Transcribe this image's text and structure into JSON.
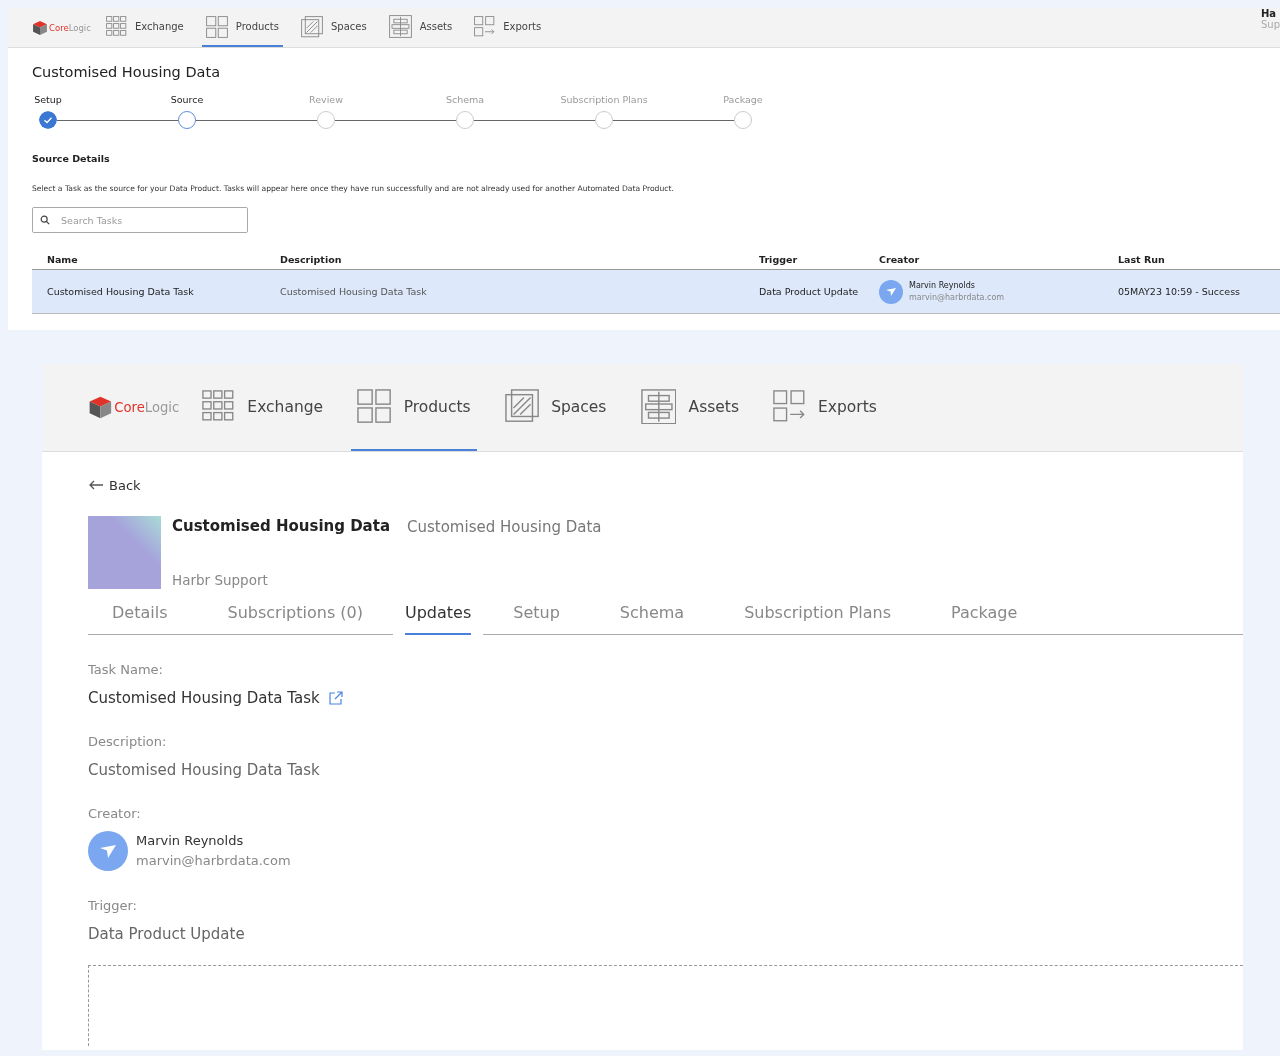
{
  "wizard": {
    "nav": {
      "brand_primary": "Core",
      "brand_secondary": "Logic",
      "items": [
        {
          "label": "Exchange",
          "selected": false
        },
        {
          "label": "Products",
          "selected": true
        },
        {
          "label": "Spaces",
          "selected": false
        },
        {
          "label": "Assets",
          "selected": false
        },
        {
          "label": "Exports",
          "selected": false
        }
      ],
      "user": {
        "name": "Ha",
        "org": "Sup"
      }
    },
    "title": "Customised Housing Data",
    "steps": [
      {
        "label": "Setup",
        "done": true,
        "current": false
      },
      {
        "label": "Source",
        "done": false,
        "current": true
      },
      {
        "label": "Review",
        "done": false,
        "current": false
      },
      {
        "label": "Schema",
        "done": false,
        "current": false
      },
      {
        "label": "Subscription Plans",
        "done": false,
        "current": false
      },
      {
        "label": "Package",
        "done": false,
        "current": false
      }
    ],
    "section_title": "Source Details",
    "hint": "Select a Task as the source for your Data Product. Tasks will appear here once they have run successfully and are not already used for another Automated Data Product.",
    "search": {
      "placeholder": "Search Tasks"
    },
    "table": {
      "columns": [
        "Name",
        "Description",
        "Trigger",
        "Creator",
        "Last Run"
      ],
      "rows": [
        {
          "selected": true,
          "name": "Customised Housing Data Task",
          "description": "Customised Housing Data Task",
          "trigger": "Data Product Update",
          "creator_name": "Marvin Reynolds",
          "creator_email": "marvin@harbrdata.com",
          "last_run": "05MAY23 10:59 - Success"
        }
      ]
    }
  },
  "detail": {
    "nav": {
      "brand_primary": "Core",
      "brand_secondary": "Logic",
      "items": [
        {
          "label": "Exchange",
          "selected": false
        },
        {
          "label": "Products",
          "selected": true
        },
        {
          "label": "Spaces",
          "selected": false
        },
        {
          "label": "Assets",
          "selected": false
        },
        {
          "label": "Exports",
          "selected": false
        }
      ]
    },
    "back": "Back",
    "product": {
      "title": "Customised Housing Data",
      "owner": "Harbr Support",
      "description": "Customised Housing Data"
    },
    "tabs": [
      {
        "label": "Details",
        "selected": false
      },
      {
        "label": "Subscriptions (0)",
        "selected": false
      },
      {
        "label": "Updates",
        "selected": true
      },
      {
        "label": "Setup",
        "selected": false
      },
      {
        "label": "Schema",
        "selected": false
      },
      {
        "label": "Subscription Plans",
        "selected": false
      },
      {
        "label": "Package",
        "selected": false
      }
    ],
    "fields": [
      {
        "kind": "link",
        "label": "Task Name:",
        "value": "Customised Housing Data Task"
      },
      {
        "kind": "text",
        "label": "Description:",
        "value": "Customised Housing Data Task"
      },
      {
        "kind": "person",
        "label": "Creator:",
        "name": "Marvin Reynolds",
        "email": "marvin@harbrdata.com"
      },
      {
        "kind": "text",
        "label": "Trigger:",
        "value": "Data Product Update"
      }
    ]
  }
}
